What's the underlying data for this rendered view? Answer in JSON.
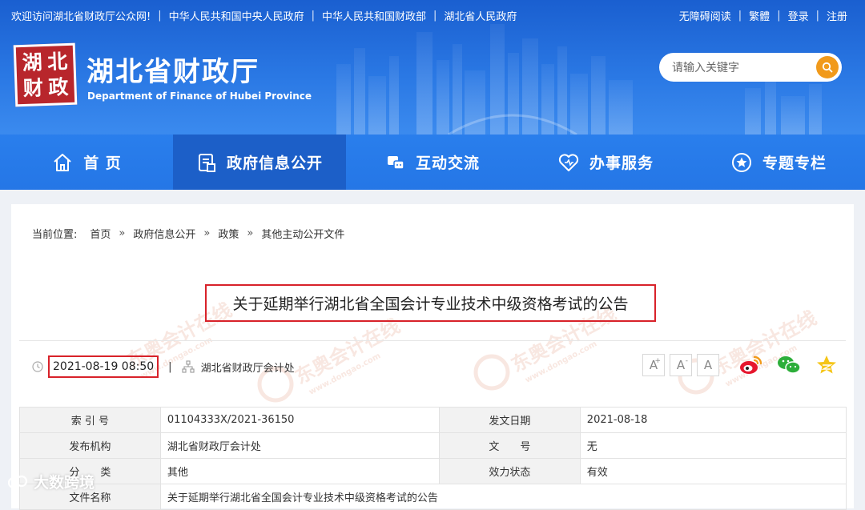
{
  "topbar": {
    "links": [
      "欢迎访问湖北省财政厅公众网!",
      "中华人民共和国中央人民政府",
      "中华人民共和国财政部",
      "湖北省人民政府"
    ],
    "right_links": [
      "无障碍阅读",
      "繁體",
      "登录",
      "注册"
    ]
  },
  "logo": {
    "seal_chars": [
      "湖",
      "北",
      "财",
      "政"
    ],
    "title": "湖北省财政厅",
    "subtitle": "Department of Finance of Hubei Province"
  },
  "search": {
    "placeholder": "请输入关键字"
  },
  "nav": {
    "items": [
      {
        "label": "首  页",
        "icon": "home-icon"
      },
      {
        "label": "政府信息公开",
        "icon": "document-icon"
      },
      {
        "label": "互动交流",
        "icon": "chat-icon"
      },
      {
        "label": "办事服务",
        "icon": "heart-icon"
      },
      {
        "label": "专题专栏",
        "icon": "star-icon"
      }
    ],
    "active_index": 1
  },
  "breadcrumb": {
    "prefix": "当前位置:",
    "items": [
      "首页",
      "政府信息公开",
      "政策",
      "其他主动公开文件"
    ],
    "separator": "»"
  },
  "article": {
    "title": "关于延期举行湖北省全国会计专业技术中级资格考试的公告",
    "publish_time": "2021-08-19 08:50",
    "source_org": "湖北省财政厅会计处"
  },
  "font_size_buttons": [
    "A",
    "A",
    "A"
  ],
  "font_size_plus": "+",
  "font_size_minus": "-",
  "share": {
    "icons": [
      "weibo-icon",
      "wechat-icon",
      "qzone-icon"
    ]
  },
  "info_table": {
    "rows": [
      [
        "索 引 号",
        "01104333X/2021-36150",
        "发文日期",
        "2021-08-18"
      ],
      [
        "发布机构",
        "湖北省财政厅会计处",
        "文　　号",
        "无"
      ],
      [
        "分　　类",
        "其他",
        "效力状态",
        "有效"
      ],
      [
        "文件名称",
        "关于延期举行湖北省全国会计专业技术中级资格考试的公告",
        "",
        ""
      ]
    ]
  },
  "watermark_text": "东奥会计在线",
  "watermark_url": "www.dongao.com",
  "corner_brand": "大数跨境",
  "colors": {
    "header_blue": "#2a78e4",
    "nav_active": "#1c5fc8",
    "highlight_red": "#d8222a",
    "seal_red": "#b8262c",
    "search_orange": "#f19a1b"
  }
}
